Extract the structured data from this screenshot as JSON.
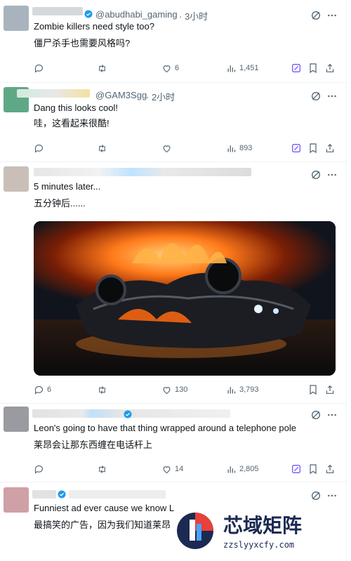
{
  "colors": {
    "text": "#0f1419",
    "muted": "#536471",
    "accent": "#1d9bf0",
    "grok": "#7856ff",
    "divider": "#eff3f4"
  },
  "tweets": [
    {
      "handle": "@abudhabi_gaming",
      "time": "· 3小时",
      "line1": "Zombie killers need style too?",
      "line2": "僵尸杀手也需要风格吗?",
      "replies": "",
      "retweets": "",
      "likes": "6",
      "views": "1,451"
    },
    {
      "handle": "@GAM3Sgg",
      "time": "· 2小时",
      "line1": "Dang this looks cool!",
      "line2": "哇，这看起来很酷!",
      "replies": "",
      "retweets": "",
      "likes": "",
      "views": "893"
    },
    {
      "handle": "",
      "time": "",
      "line1": "5 minutes later...",
      "line2": "五分钟后......",
      "replies": "6",
      "retweets": "",
      "likes": "130",
      "views": "3,793"
    },
    {
      "handle": "",
      "time": "",
      "line1": "Leon's going to have that thing wrapped around a telephone pole",
      "line2": "莱昂会让那东西缠在电话杆上",
      "replies": "",
      "retweets": "",
      "likes": "14",
      "views": "2,805"
    },
    {
      "handle": "",
      "time": "",
      "line1": "Funniest ad ever cause we know L",
      "line2": "最搞笑的广告，因为我们知道莱昂",
      "replies": "",
      "retweets": "",
      "likes": "",
      "views": ""
    }
  ],
  "icons": [
    "grok-icon",
    "more-icon",
    "reply-icon",
    "retweet-icon",
    "like-icon",
    "views-icon",
    "bookmark-icon",
    "share-icon",
    "verified-icon"
  ],
  "watermark": {
    "title": "芯域矩阵",
    "url": "zzslyyxcfy.com"
  }
}
